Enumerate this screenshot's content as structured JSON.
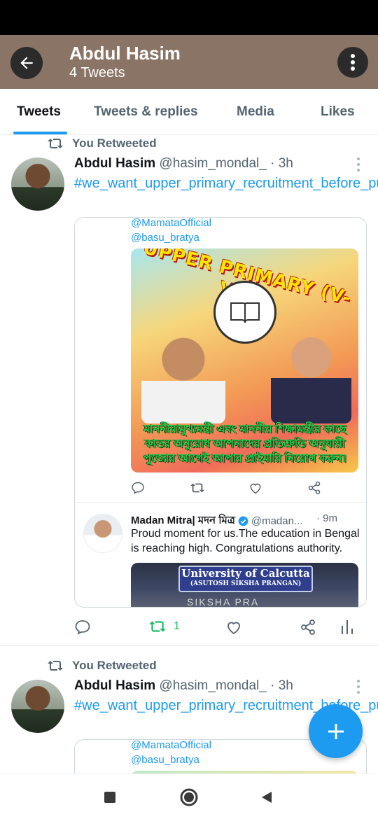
{
  "header": {
    "name": "Abdul Hasim",
    "tweet_count": "4 Tweets"
  },
  "tabs": [
    {
      "label": "Tweets",
      "active": true
    },
    {
      "label": "Tweets & replies",
      "active": false
    },
    {
      "label": "Media",
      "active": false
    },
    {
      "label": "Likes",
      "active": false
    }
  ],
  "tweets": [
    {
      "retweet_label": "You Retweeted",
      "name": "Abdul Hasim",
      "handle_time": "@hasim_mondal_ · 3h",
      "hashtag": "#we_want_upper_primary_recruitment_before_puja_vacation",
      "quote": {
        "mentions": [
          "@MamataOfficial",
          "@basu_bratya"
        ],
        "poster_title": "UPPER PRIMARY (V-VIII)",
        "poster_caption": "মাননীয়ামুখ্যমন্ত্রী এবং মাননীয় শিক্ষামন্ত্রীর কাছে কাতর অনুরোধ আপনাদের প্রতিশ্রুতি অনুযায়ী পুজোর আগেই আপার প্রাইমারি নিয়োগ করুন।",
        "nested": {
          "name": "Madan Mitra| মদন মিত্র",
          "handle": "@madan...",
          "time": "· 9m",
          "text": "Proud moment for us.The education in Bengal is reaching high. Congratulations authority.",
          "image_banner": "University of Calcutta",
          "image_subbanner": "(ASUTOSH SIKSHA PRANGAN)",
          "image_text": "SIKSHA PRA"
        }
      },
      "retweet_count": "1"
    },
    {
      "retweet_label": "You Retweeted",
      "name": "Abdul Hasim",
      "handle_time": "@hasim_mondal_ · 3h",
      "hashtag": "#we_want_upper_primary_recruitment_before_puja_vacation",
      "quote": {
        "mentions": [
          "@MamataOfficial",
          "@basu_bratya"
        ]
      }
    }
  ],
  "colors": {
    "accent": "#1d9bf0",
    "header_bg": "#8a7465",
    "retweet_green": "#17bf63"
  },
  "icons": [
    "back-arrow-icon",
    "more-vertical-icon",
    "retweet-icon",
    "reply-icon",
    "like-icon",
    "share-icon",
    "analytics-icon",
    "verified-icon",
    "plus-icon",
    "nav-square-icon",
    "nav-circle-icon",
    "nav-triangle-icon"
  ]
}
